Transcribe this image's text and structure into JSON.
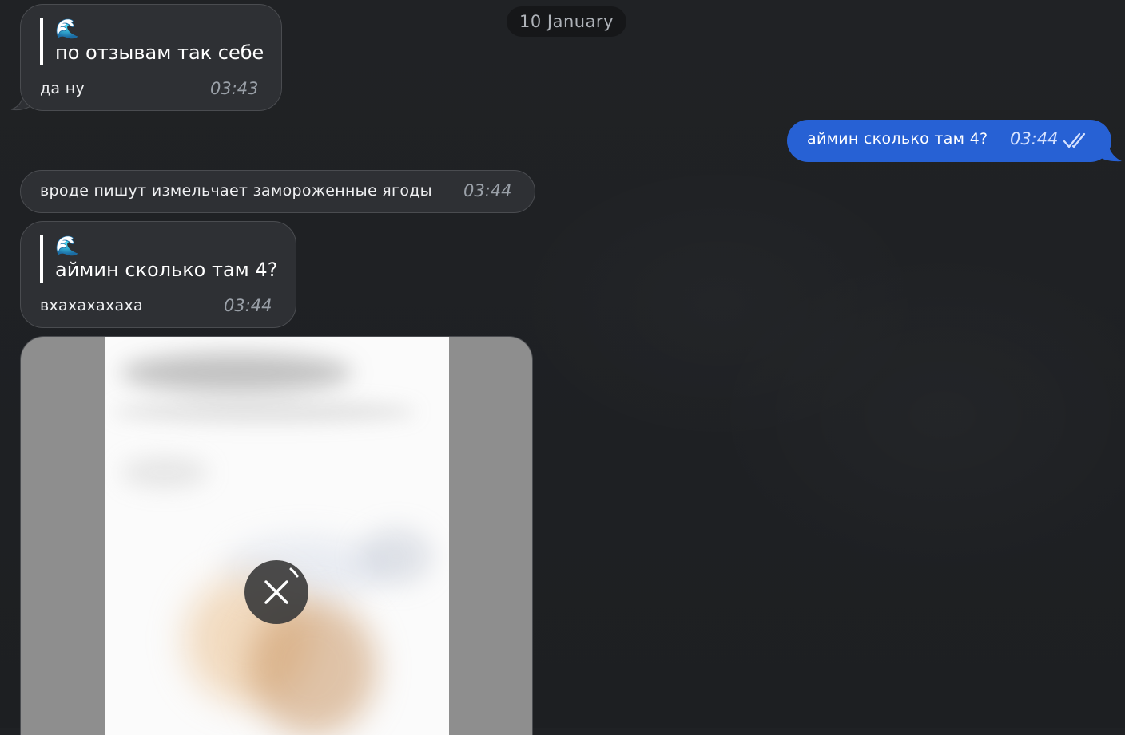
{
  "chat": {
    "date_separator": "10 January",
    "messages": [
      {
        "direction": "incoming",
        "reply_emoji": "🌊",
        "reply_text": "по отзывам так себе",
        "text": "да ну",
        "time": "03:43"
      },
      {
        "direction": "outgoing",
        "text": "аймин сколько там 4?",
        "time": "03:44",
        "status_icon": "double-check-icon"
      },
      {
        "direction": "incoming",
        "text": "вроде пишут измельчает замороженные ягоды",
        "time": "03:44"
      },
      {
        "direction": "incoming",
        "reply_emoji": "🌊",
        "reply_text": "аймин сколько там 4?",
        "text": "вхахахахаха",
        "time": "03:44"
      },
      {
        "direction": "incoming",
        "type": "image",
        "status": "loading",
        "control_icon": "close-icon"
      }
    ]
  },
  "colors": {
    "background": "#1f2124",
    "incoming_bubble": "#2e3034",
    "outgoing_bubble": "#2761d4",
    "date_pill": "#161719"
  }
}
